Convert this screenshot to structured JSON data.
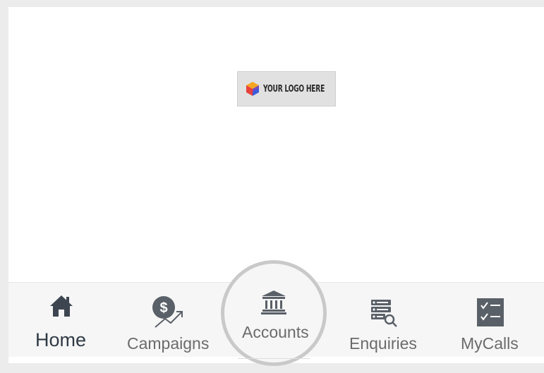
{
  "logo": {
    "text": "YOUR LOGO HERE",
    "icon": "cube-logo-icon"
  },
  "bottom_nav": {
    "active": "Home",
    "items": [
      {
        "label": "Home",
        "icon": "home-icon"
      },
      {
        "label": "Campaigns",
        "icon": "dollar-growth-icon"
      },
      {
        "label": "Accounts",
        "icon": "bank-icon"
      },
      {
        "label": "Enquiries",
        "icon": "list-search-icon"
      },
      {
        "label": "MyCalls",
        "icon": "checklist-icon"
      }
    ]
  },
  "colors": {
    "active_text": "#2f3a45",
    "inactive_text": "#6b6b6b",
    "icon": "#3d4650",
    "highlight_ring": "#c9c9c9",
    "nav_bg": "#f6f6f6"
  }
}
